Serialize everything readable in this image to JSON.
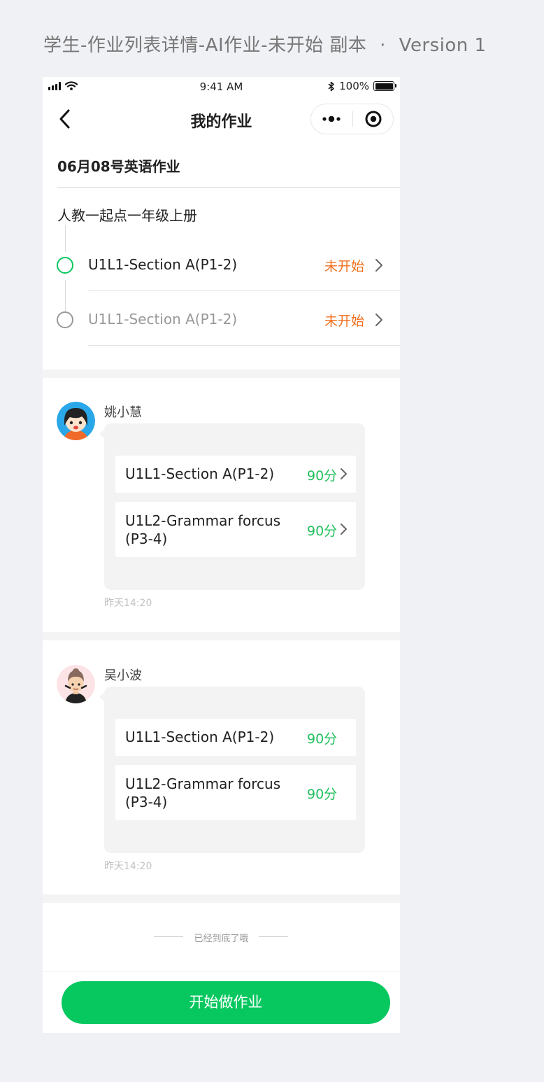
{
  "artboard": {
    "title": "学生-作业列表详情-AI作业-未开始 副本",
    "separator": "·",
    "version": "Version 1"
  },
  "status_bar": {
    "time": "9:41 AM",
    "battery": "100%",
    "battery_level": 1.0
  },
  "nav": {
    "back_icon": "chevron-left-icon",
    "title": "我的作业",
    "more_icon": "more-dots-icon",
    "close_icon": "target-circle-icon"
  },
  "homework": {
    "title": "06月08号英语作业",
    "book": "人教一起点一年级上册",
    "lessons": [
      {
        "name": "U1L1-Section A(P1-2)",
        "status": "未开始",
        "active": true
      },
      {
        "name": "U1L1-Section A(P1-2)",
        "status": "未开始",
        "active": false
      }
    ]
  },
  "messages": [
    {
      "sender": "姚小慧",
      "avatar_icon": "girl-avatar",
      "items": [
        {
          "name": "U1L1-Section A(P1-2)",
          "score": "90分",
          "has_arrow": true
        },
        {
          "name": "U1L2-Grammar forcus (P3-4)",
          "score": "90分",
          "has_arrow": true
        }
      ],
      "time": "昨天14:20"
    },
    {
      "sender": "吴小波",
      "avatar_icon": "boy-avatar",
      "items": [
        {
          "name": "U1L1-Section A(P1-2)",
          "score": "90分",
          "has_arrow": false
        },
        {
          "name": "U1L2-Grammar forcus (P3-4)",
          "score": "90分",
          "has_arrow": false
        }
      ],
      "time": "昨天14:20"
    }
  ],
  "footer": {
    "end_text": "已经到底了哦",
    "start_button": "开始做作业"
  },
  "colors": {
    "accent_green": "#07c75f",
    "score_green": "#20c05c",
    "status_orange": "#f07020",
    "bubble_gray": "#f3f3f3"
  }
}
